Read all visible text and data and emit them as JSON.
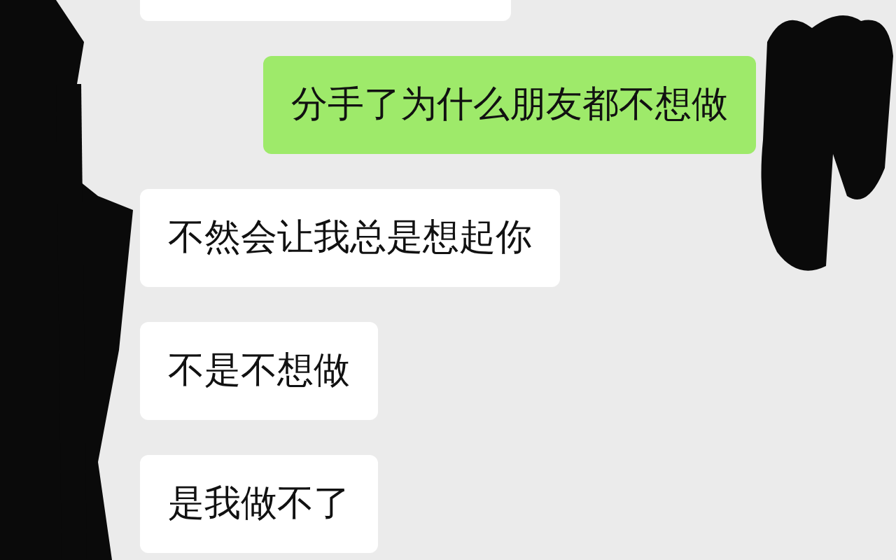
{
  "messages": [
    {
      "kind": "sent",
      "text": "分手了为什么朋友都不想做"
    },
    {
      "kind": "received",
      "text": "不然会让我总是想起你"
    },
    {
      "kind": "received",
      "text": "不是不想做"
    },
    {
      "kind": "received",
      "text": "是我做不了"
    }
  ]
}
